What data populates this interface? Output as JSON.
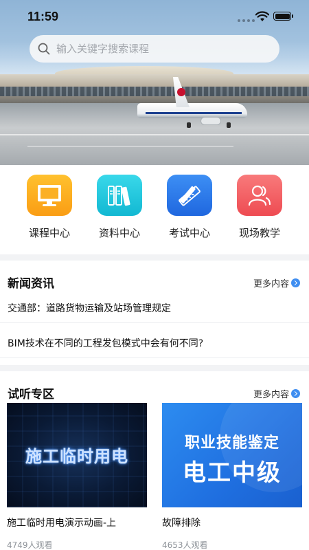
{
  "status_bar": {
    "time": "11:59"
  },
  "search": {
    "placeholder": "输入关键字搜索课程"
  },
  "categories": [
    {
      "label": "课程中心",
      "icon": "monitor-icon",
      "color": "#fdae1b"
    },
    {
      "label": "资料中心",
      "icon": "books-icon",
      "color": "#1ec6dc"
    },
    {
      "label": "考试中心",
      "icon": "pencil-ruler-icon",
      "color": "#2f7df0"
    },
    {
      "label": "现场教学",
      "icon": "users-icon",
      "color": "#f0565a"
    }
  ],
  "news": {
    "title": "新闻资讯",
    "more": "更多内容",
    "items": [
      "交通部：道路货物运输及站场管理规定",
      "BIM技术在不同的工程发包模式中会有何不同?"
    ]
  },
  "trial": {
    "title": "试听专区",
    "more": "更多内容",
    "courses": [
      {
        "thumb_text": "施工临时用电",
        "title": "施工临时用电演示动画-上",
        "views": "4749人观看"
      },
      {
        "thumb_line1": "职业技能鉴定",
        "thumb_line2": "电工中级",
        "title": "故障排除",
        "views": "4653人观看"
      }
    ]
  },
  "colors": {
    "accent": "#3f8ef0"
  }
}
